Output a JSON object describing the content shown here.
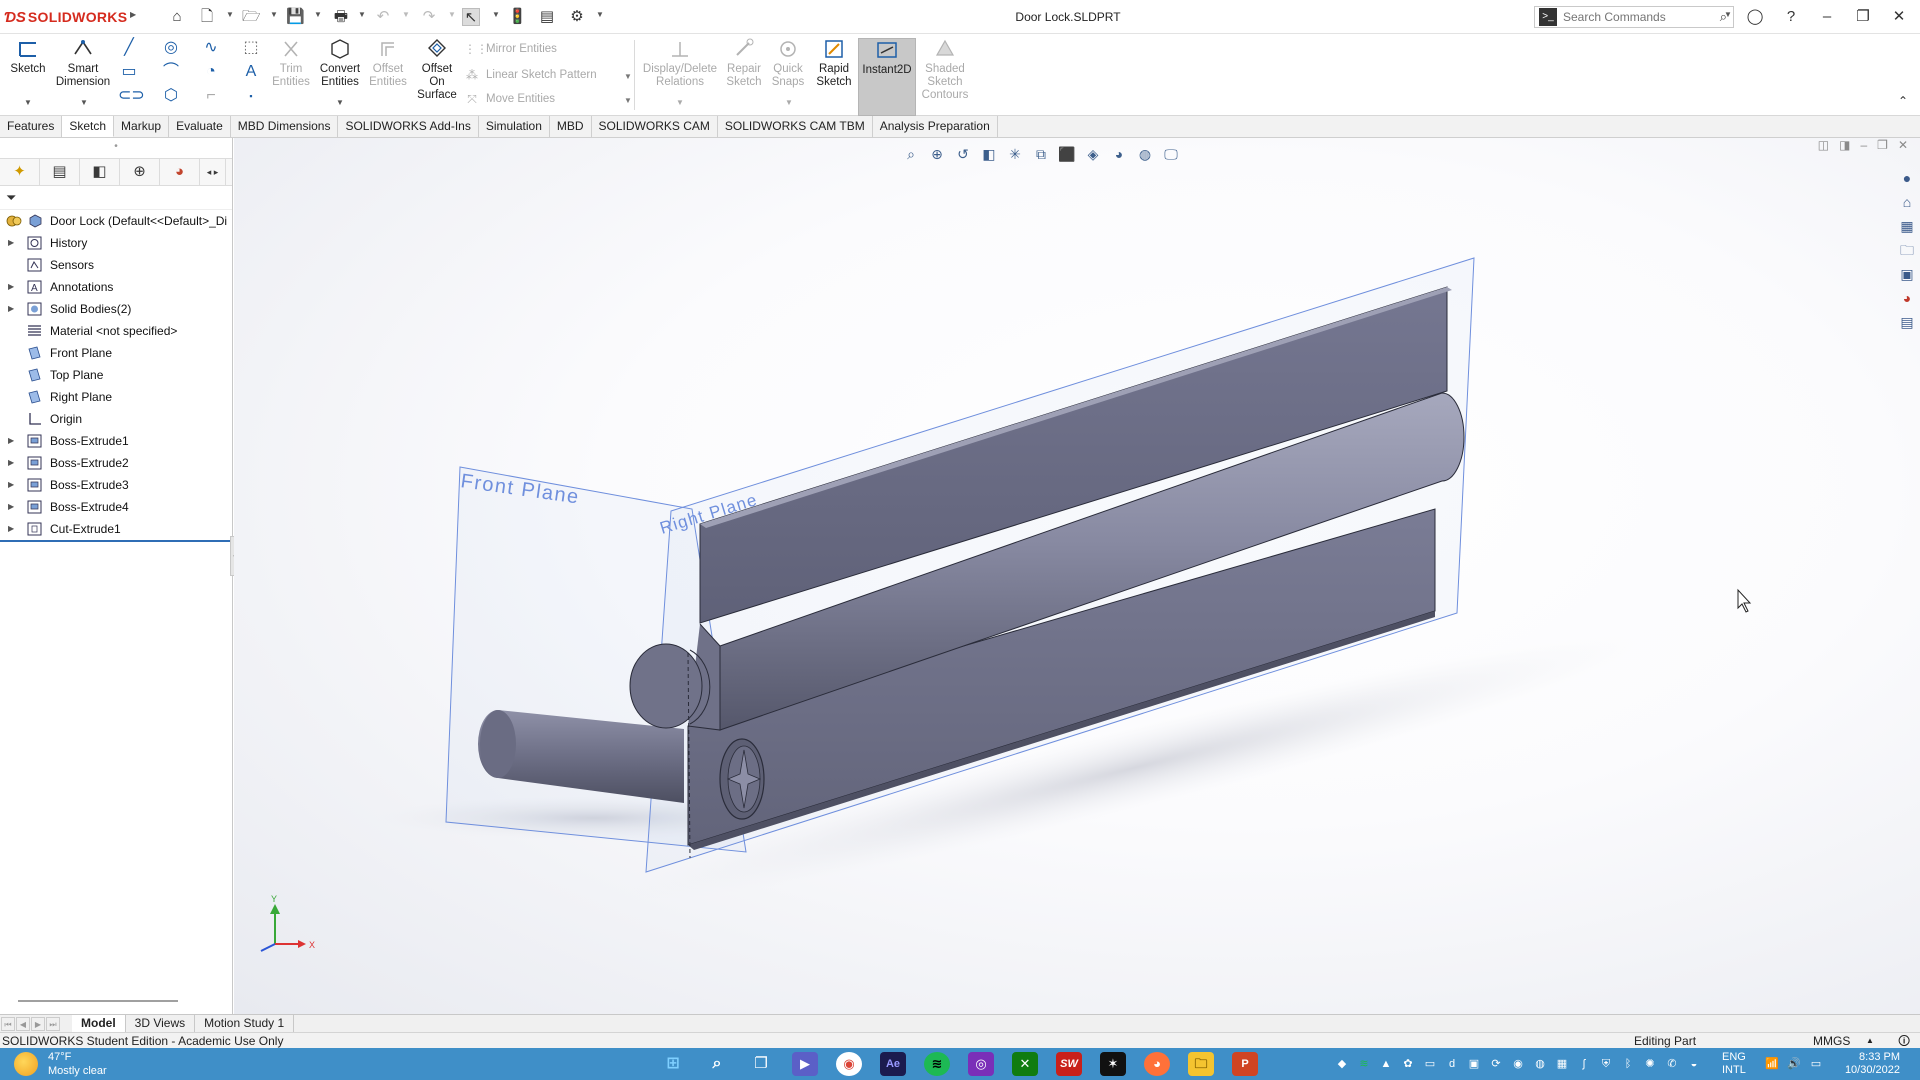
{
  "app": {
    "brand": "SOLIDWORKS",
    "document_title": "Door Lock.SLDPRT",
    "search_placeholder": "Search Commands"
  },
  "ribbon": {
    "sketch": "Sketch",
    "smart_dimension": "Smart Dimension",
    "trim_entities": "Trim Entities",
    "convert_entities": "Convert Entities",
    "offset_entities": "Offset Entities",
    "offset_on_surface": "Offset On Surface",
    "mirror_entities": "Mirror Entities",
    "linear_sketch_pattern": "Linear Sketch Pattern",
    "move_entities": "Move Entities",
    "display_delete_relations": "Display/Delete Relations",
    "repair_sketch": "Repair Sketch",
    "quick_snaps": "Quick Snaps",
    "rapid_sketch": "Rapid Sketch",
    "instant2d": "Instant2D",
    "shaded_sketch_contours": "Shaded Sketch Contours"
  },
  "tabs": [
    "Features",
    "Sketch",
    "Markup",
    "Evaluate",
    "MBD Dimensions",
    "SOLIDWORKS Add-Ins",
    "Simulation",
    "MBD",
    "SOLIDWORKS CAM",
    "SOLIDWORKS CAM TBM",
    "Analysis Preparation"
  ],
  "active_tab": "Sketch",
  "tree": {
    "root": "Door Lock  (Default<<Default>_Di",
    "items": [
      {
        "label": "History",
        "expandable": true,
        "icon": "history-icon"
      },
      {
        "label": "Sensors",
        "expandable": false,
        "icon": "sensors-icon"
      },
      {
        "label": "Annotations",
        "expandable": true,
        "icon": "annotations-icon"
      },
      {
        "label": "Solid Bodies(2)",
        "expandable": true,
        "icon": "solid-bodies-icon"
      },
      {
        "label": "Material <not specified>",
        "expandable": false,
        "icon": "material-icon"
      },
      {
        "label": "Front Plane",
        "expandable": false,
        "icon": "plane-icon"
      },
      {
        "label": "Top Plane",
        "expandable": false,
        "icon": "plane-icon"
      },
      {
        "label": "Right Plane",
        "expandable": false,
        "icon": "plane-icon"
      },
      {
        "label": "Origin",
        "expandable": false,
        "icon": "origin-icon"
      },
      {
        "label": "Boss-Extrude1",
        "expandable": true,
        "icon": "extrude-icon"
      },
      {
        "label": "Boss-Extrude2",
        "expandable": true,
        "icon": "extrude-icon"
      },
      {
        "label": "Boss-Extrude3",
        "expandable": true,
        "icon": "extrude-icon"
      },
      {
        "label": "Boss-Extrude4",
        "expandable": true,
        "icon": "extrude-icon"
      },
      {
        "label": "Cut-Extrude1",
        "expandable": true,
        "icon": "cut-extrude-icon"
      }
    ]
  },
  "viewport": {
    "front_plane_label": "Front Plane",
    "right_plane_label": "Right Plane",
    "triad": {
      "x": "X",
      "y": "Y"
    }
  },
  "bottom_tabs": [
    "Model",
    "3D Views",
    "Motion Study 1"
  ],
  "active_bottom_tab": "Model",
  "status": {
    "left": "SOLIDWORKS Student Edition - Academic Use Only",
    "mode": "Editing Part",
    "units": "MMGS"
  },
  "taskbar": {
    "temperature": "47°F",
    "weather": "Mostly clear",
    "lang_line1": "ENG",
    "lang_line2": "INTL",
    "time": "8:33 PM",
    "date": "10/30/2022"
  },
  "colors": {
    "brand_red": "#d52b1e",
    "taskbar_blue": "#3f8fc8",
    "plane_blue": "#5b7fd6",
    "body_gray": "#6e7086"
  }
}
